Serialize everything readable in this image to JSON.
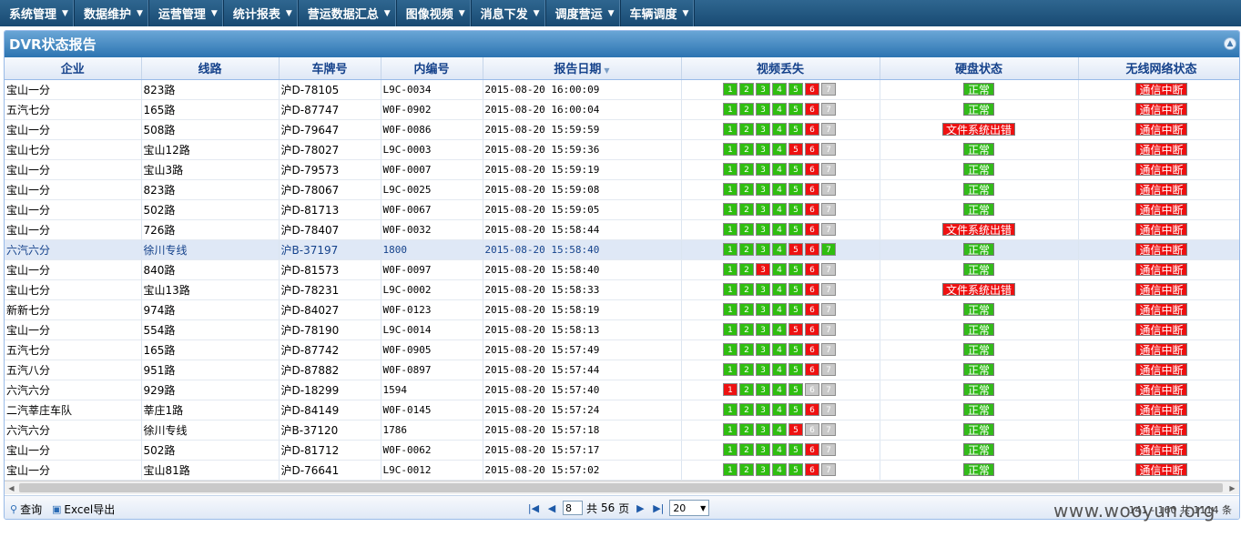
{
  "menu": [
    {
      "label": "系统管理"
    },
    {
      "label": "数据维护"
    },
    {
      "label": "运营管理"
    },
    {
      "label": "统计报表"
    },
    {
      "label": "营运数据汇总"
    },
    {
      "label": "图像视频"
    },
    {
      "label": "消息下发"
    },
    {
      "label": "调度营运"
    },
    {
      "label": "车辆调度"
    }
  ],
  "panel": {
    "title": "DVR状态报告"
  },
  "columns": {
    "company": "企业",
    "route": "线路",
    "plate": "车牌号",
    "code": "内编号",
    "date": "报告日期",
    "video": "视频丢失",
    "disk": "硬盘状态",
    "network": "无线网络状态"
  },
  "video_channels": [
    "1",
    "2",
    "3",
    "4",
    "5",
    "6",
    "7"
  ],
  "rows": [
    {
      "company": "宝山一分",
      "route": "823路",
      "plate": "沪D-78105",
      "code": "L9C-0034",
      "date": "2015-08-20 16:00:09",
      "video": "gggggrx",
      "disk": "正常",
      "disk_error": false,
      "network": "通信中断"
    },
    {
      "company": "五汽七分",
      "route": "165路",
      "plate": "沪D-87747",
      "code": "W0F-0902",
      "date": "2015-08-20 16:00:04",
      "video": "gggggrx",
      "disk": "正常",
      "disk_error": false,
      "network": "通信中断"
    },
    {
      "company": "宝山一分",
      "route": "508路",
      "plate": "沪D-79647",
      "code": "W0F-0086",
      "date": "2015-08-20 15:59:59",
      "video": "gggggrx",
      "disk": "文件系统出错",
      "disk_error": true,
      "network": "通信中断"
    },
    {
      "company": "宝山七分",
      "route": "宝山12路",
      "plate": "沪D-78027",
      "code": "L9C-0003",
      "date": "2015-08-20 15:59:36",
      "video": "ggggrrx",
      "disk": "正常",
      "disk_error": false,
      "network": "通信中断"
    },
    {
      "company": "宝山一分",
      "route": "宝山3路",
      "plate": "沪D-79573",
      "code": "W0F-0007",
      "date": "2015-08-20 15:59:19",
      "video": "gggggrx",
      "disk": "正常",
      "disk_error": false,
      "network": "通信中断"
    },
    {
      "company": "宝山一分",
      "route": "823路",
      "plate": "沪D-78067",
      "code": "L9C-0025",
      "date": "2015-08-20 15:59:08",
      "video": "gggggrx",
      "disk": "正常",
      "disk_error": false,
      "network": "通信中断"
    },
    {
      "company": "宝山一分",
      "route": "502路",
      "plate": "沪D-81713",
      "code": "W0F-0067",
      "date": "2015-08-20 15:59:05",
      "video": "gggggrx",
      "disk": "正常",
      "disk_error": false,
      "network": "通信中断"
    },
    {
      "company": "宝山一分",
      "route": "726路",
      "plate": "沪D-78407",
      "code": "W0F-0032",
      "date": "2015-08-20 15:58:44",
      "video": "gggggrx",
      "disk": "文件系统出错",
      "disk_error": true,
      "network": "通信中断"
    },
    {
      "company": "六汽六分",
      "route": "徐川专线",
      "plate": "沪B-37197",
      "code": "1800",
      "date": "2015-08-20 15:58:40",
      "video": "ggggrrg",
      "disk": "正常",
      "disk_error": false,
      "network": "通信中断",
      "selected": true
    },
    {
      "company": "宝山一分",
      "route": "840路",
      "plate": "沪D-81573",
      "code": "W0F-0097",
      "date": "2015-08-20 15:58:40",
      "video": "ggrggrx",
      "disk": "正常",
      "disk_error": false,
      "network": "通信中断"
    },
    {
      "company": "宝山七分",
      "route": "宝山13路",
      "plate": "沪D-78231",
      "code": "L9C-0002",
      "date": "2015-08-20 15:58:33",
      "video": "gggggrx",
      "disk": "文件系统出错",
      "disk_error": true,
      "network": "通信中断"
    },
    {
      "company": "新新七分",
      "route": "974路",
      "plate": "沪D-84027",
      "code": "W0F-0123",
      "date": "2015-08-20 15:58:19",
      "video": "gggggrx",
      "disk": "正常",
      "disk_error": false,
      "network": "通信中断"
    },
    {
      "company": "宝山一分",
      "route": "554路",
      "plate": "沪D-78190",
      "code": "L9C-0014",
      "date": "2015-08-20 15:58:13",
      "video": "ggggrrx",
      "disk": "正常",
      "disk_error": false,
      "network": "通信中断"
    },
    {
      "company": "五汽七分",
      "route": "165路",
      "plate": "沪D-87742",
      "code": "W0F-0905",
      "date": "2015-08-20 15:57:49",
      "video": "gggggrx",
      "disk": "正常",
      "disk_error": false,
      "network": "通信中断"
    },
    {
      "company": "五汽八分",
      "route": "951路",
      "plate": "沪D-87882",
      "code": "W0F-0897",
      "date": "2015-08-20 15:57:44",
      "video": "gggggrx",
      "disk": "正常",
      "disk_error": false,
      "network": "通信中断"
    },
    {
      "company": "六汽六分",
      "route": "929路",
      "plate": "沪D-18299",
      "code": "1594",
      "date": "2015-08-20 15:57:40",
      "video": "rggggxx",
      "disk": "正常",
      "disk_error": false,
      "network": "通信中断"
    },
    {
      "company": "二汽莘庄车队",
      "route": "莘庄1路",
      "plate": "沪D-84149",
      "code": "W0F-0145",
      "date": "2015-08-20 15:57:24",
      "video": "gggggrx",
      "disk": "正常",
      "disk_error": false,
      "network": "通信中断"
    },
    {
      "company": "六汽六分",
      "route": "徐川专线",
      "plate": "沪B-37120",
      "code": "1786",
      "date": "2015-08-20 15:57:18",
      "video": "ggggrxx",
      "disk": "正常",
      "disk_error": false,
      "network": "通信中断"
    },
    {
      "company": "宝山一分",
      "route": "502路",
      "plate": "沪D-81712",
      "code": "W0F-0062",
      "date": "2015-08-20 15:57:17",
      "video": "gggggrx",
      "disk": "正常",
      "disk_error": false,
      "network": "通信中断"
    },
    {
      "company": "宝山一分",
      "route": "宝山81路",
      "plate": "沪D-76641",
      "code": "L9C-0012",
      "date": "2015-08-20 15:57:02",
      "video": "gggggrx",
      "disk": "正常",
      "disk_error": false,
      "network": "通信中断"
    }
  ],
  "toolbar": {
    "query_label": "查询",
    "export_label": "Excel导出"
  },
  "pager": {
    "page_value": "8",
    "total_prefix": "共",
    "total_pages": "56",
    "page_suffix": "页",
    "page_size": "20",
    "info": "141 - 160  共 1114 条"
  },
  "watermark": "www.wooyun.org",
  "colors": {
    "ok": "#33bb1a",
    "error": "#ee1111",
    "missing": "#c8c8c8",
    "header": "#15428b"
  }
}
